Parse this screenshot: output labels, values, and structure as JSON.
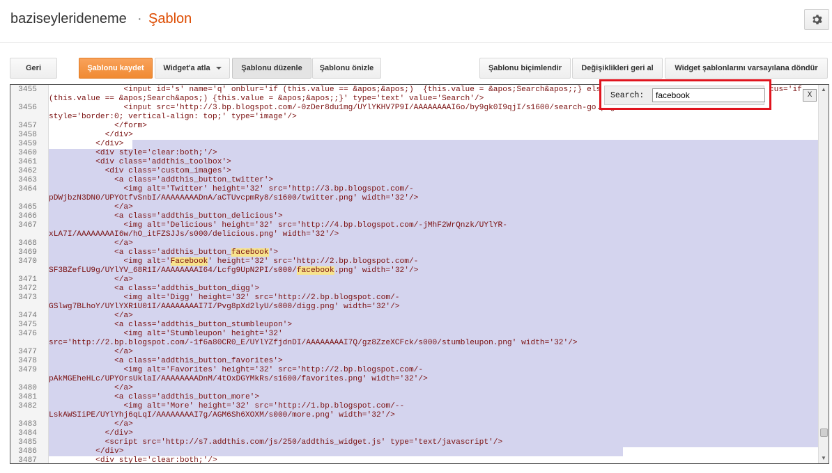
{
  "header": {
    "blog_name": "baziseylerideneme",
    "separator": "·",
    "page_title": "Şablon"
  },
  "toolbar": {
    "back": "Geri",
    "save": "Şablonu kaydet",
    "jump_widget": "Widget'a atla",
    "edit_template": "Şablonu düzenle",
    "preview": "Şablonu önizle",
    "format": "Şablonu biçimlendir",
    "revert": "Değişiklikleri geri al",
    "reset_widgets": "Widget şablonlarını varsayılana döndür"
  },
  "search": {
    "label": "Search:",
    "value": "facebook",
    "close": "X"
  },
  "icons": {
    "gear": "gear-icon",
    "caret": "chevron-down-icon"
  },
  "code_lines": [
    {
      "n": "3455",
      "t": "                <input id='s' name='q' onblur='if (this.value == &apos;&apos;)  {this.value = &apos;Search&apos;;} else {this.value = &apos;&apos;;}' onfocus='if"
    },
    {
      "n": "",
      "t": "(this.value == &apos;Search&apos;) {this.value = &apos;&apos;;}' type='text' value='Search'/>"
    },
    {
      "n": "3456",
      "t": "                <input src='http://3.bp.blogspot.com/-0zDer8du1mg/UYlYKHV7P9I/AAAAAAAAI6o/by9gk0I9qjI/s1600/search-go.png'"
    },
    {
      "n": "",
      "t": "style='border:0; vertical-align: top;' type='image'/>"
    },
    {
      "n": "3457",
      "t": "              </form>"
    },
    {
      "n": "3458",
      "t": "            </div>"
    },
    {
      "n": "3459",
      "t": "          </div>"
    },
    {
      "n": "3460",
      "t": "          <div style='clear:both;'/>"
    },
    {
      "n": "3461",
      "t": "          <div class='addthis_toolbox'>"
    },
    {
      "n": "3462",
      "t": "            <div class='custom_images'>"
    },
    {
      "n": "3463",
      "t": "              <a class='addthis_button_twitter'>"
    },
    {
      "n": "3464",
      "t": "                <img alt='Twitter' height='32' src='http://3.bp.blogspot.com/-"
    },
    {
      "n": "",
      "t": "pDWjbzN3DN0/UPYOtfvSnbI/AAAAAAAADnA/aCTUvcpmRy8/s1600/twitter.png' width='32'/>"
    },
    {
      "n": "3465",
      "t": "              </a>"
    },
    {
      "n": "3466",
      "t": "              <a class='addthis_button_delicious'>"
    },
    {
      "n": "3467",
      "t": "                <img alt='Delicious' height='32' src='http://4.bp.blogspot.com/-jMhF2WrQnzk/UYlYR-"
    },
    {
      "n": "",
      "t": "xLA7I/AAAAAAAAI6w/hO_itFZSJJs/s000/delicious.png' width='32'/>"
    },
    {
      "n": "3468",
      "t": "              </a>"
    },
    {
      "n": "3469",
      "t": "              <a class='addthis_button_facebook'>"
    },
    {
      "n": "3470",
      "t": "                <img alt='Facebook' height='32' src='http://2.bp.blogspot.com/-"
    },
    {
      "n": "",
      "t": "SF3BZefLU9g/UYlYV_68R1I/AAAAAAAAI64/Lcfg9UpN2PI/s000/facebook.png' width='32'/>"
    },
    {
      "n": "3471",
      "t": "              </a>"
    },
    {
      "n": "3472",
      "t": "              <a class='addthis_button_digg'>"
    },
    {
      "n": "3473",
      "t": "                <img alt='Digg' height='32' src='http://2.bp.blogspot.com/-"
    },
    {
      "n": "",
      "t": "GSlwg7BLhoY/UYlYXR1U01I/AAAAAAAAI7I/Pvg8pXd2lyU/s000/digg.png' width='32'/>"
    },
    {
      "n": "3474",
      "t": "              </a>"
    },
    {
      "n": "3475",
      "t": "              <a class='addthis_button_stumbleupon'>"
    },
    {
      "n": "3476",
      "t": "                <img alt='Stumbleupon' height='32'"
    },
    {
      "n": "",
      "t": "src='http://2.bp.blogspot.com/-1f6a80CR0_E/UYlYZfjdnDI/AAAAAAAAI7Q/gz8ZzeXCFck/s000/stumbleupon.png' width='32'/>"
    },
    {
      "n": "3477",
      "t": "              </a>"
    },
    {
      "n": "3478",
      "t": "              <a class='addthis_button_favorites'>"
    },
    {
      "n": "3479",
      "t": "                <img alt='Favorites' height='32' src='http://2.bp.blogspot.com/-"
    },
    {
      "n": "",
      "t": "pAkMGEheHLc/UPYOrsUklaI/AAAAAAAADnM/4tOxDGYMkRs/s1600/favorites.png' width='32'/>"
    },
    {
      "n": "3480",
      "t": "              </a>"
    },
    {
      "n": "3481",
      "t": "              <a class='addthis_button_more'>"
    },
    {
      "n": "3482",
      "t": "                <img alt='More' height='32' src='http://1.bp.blogspot.com/--"
    },
    {
      "n": "",
      "t": "LskAWSIiPE/UYlYhj6qLqI/AAAAAAAAI7g/AGM6Sh6XOXM/s000/more.png' width='32'/>"
    },
    {
      "n": "3483",
      "t": "              </a>"
    },
    {
      "n": "3484",
      "t": "            </div>"
    },
    {
      "n": "3485",
      "t": "            <script src='http://s7.addthis.com/js/250/addthis_widget.js' type='text/javascript'/>"
    },
    {
      "n": "3486",
      "t": "          </div>"
    },
    {
      "n": "3487",
      "t": "          <div style='clear:both;'/>"
    }
  ]
}
